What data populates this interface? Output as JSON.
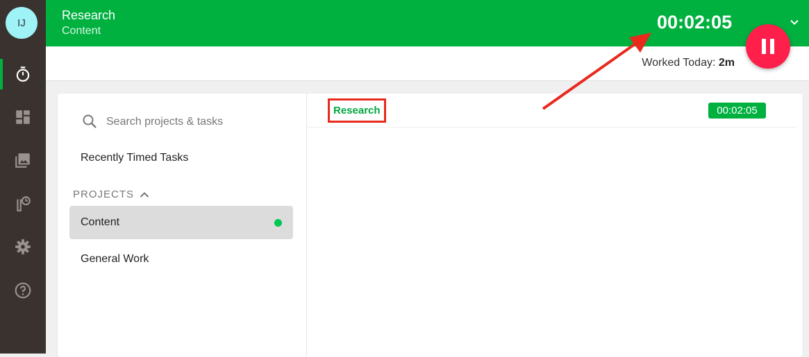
{
  "user": {
    "initials": "IJ"
  },
  "topbar": {
    "title": "Research",
    "subtitle": "Content",
    "timer": "00:02:05"
  },
  "subbar": {
    "worked_label": "Worked Today:",
    "worked_value": "2m"
  },
  "search": {
    "placeholder": "Search projects & tasks"
  },
  "sidebar": {
    "recent_label": "Recently Timed Tasks",
    "projects_header": "PROJECTS"
  },
  "projects": [
    {
      "label": "Content",
      "active": true
    },
    {
      "label": "General Work",
      "active": false
    }
  ],
  "task": {
    "name": "Research",
    "time": "00:02:05"
  },
  "colors": {
    "brand_green": "#00b140",
    "pause_red": "#ff1f4b",
    "annotation_red": "#e8291c"
  }
}
